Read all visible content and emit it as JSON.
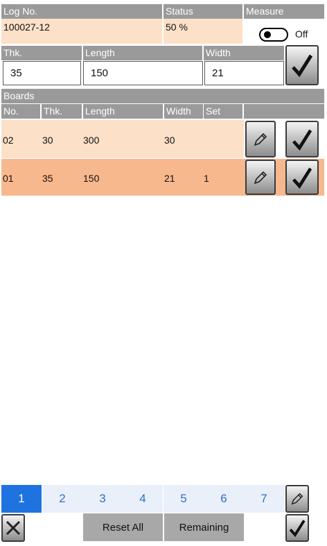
{
  "header": {
    "log_no_label": "Log No.",
    "status_label": "Status",
    "measure_label": "Measure",
    "log_no_value": "100027-12",
    "status_value": "50 %",
    "measure_toggle_label": "Off"
  },
  "entry": {
    "thk_label": "Thk.",
    "length_label": "Length",
    "width_label": "Width",
    "thk_value": "35",
    "length_value": "150",
    "width_value": "21"
  },
  "boards": {
    "title": "Boards",
    "columns": [
      "No.",
      "Thk.",
      "Length",
      "Width",
      "Set"
    ],
    "rows": [
      {
        "no": "02",
        "thk": "30",
        "length": "300",
        "width": "30",
        "set": ""
      },
      {
        "no": "01",
        "thk": "35",
        "length": "150",
        "width": "21",
        "set": "1"
      }
    ]
  },
  "pager": {
    "pages": [
      "1",
      "2",
      "3",
      "4",
      "5",
      "6",
      "7"
    ],
    "active_page": "1"
  },
  "footer": {
    "reset_all_label": "Reset All",
    "remaining_label": "Remaining"
  },
  "colors": {
    "header_gray": "#9a9a9a",
    "row_peach": "#fde0c8",
    "row_orange": "#f8b88e",
    "accent_blue": "#1f73e0"
  },
  "icons": [
    "check-icon",
    "pencil-icon",
    "close-icon"
  ]
}
